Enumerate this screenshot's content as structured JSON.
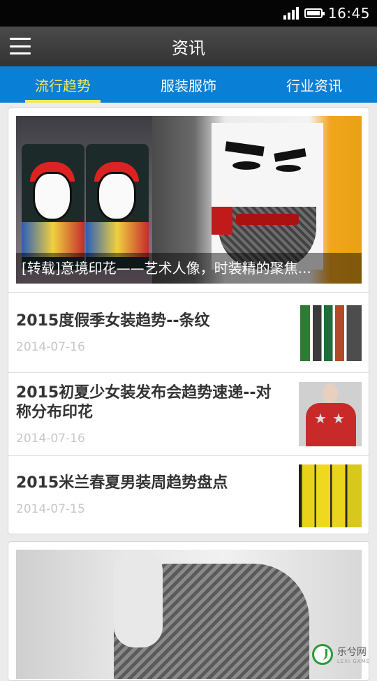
{
  "status": {
    "time": "16:45"
  },
  "appbar": {
    "title": "资讯",
    "menu_icon": "hamburger-menu-icon"
  },
  "tabs": [
    {
      "label": "流行趋势",
      "active": true
    },
    {
      "label": "服装服饰",
      "active": false
    },
    {
      "label": "行业资讯",
      "active": false
    }
  ],
  "featured": {
    "caption": "[转载]意境印花——艺术人像，时装精的聚焦..."
  },
  "articles": [
    {
      "title": "2015度假季女装趋势--条纹",
      "date": "2014-07-16"
    },
    {
      "title_line1": "2015初夏少女装发布会趋势速递--对",
      "title_line2": "称分布印花",
      "date": "2014-07-16"
    },
    {
      "title": "2015米兰春夏男装周趋势盘点",
      "date": "2014-07-15"
    }
  ],
  "watermark": {
    "name": "乐兮网",
    "sub": "LEXI GAME"
  },
  "colors": {
    "tab_bar": "#0a7fd6",
    "tab_active": "#f0ea5a",
    "appbar": "#3c3c3c"
  }
}
